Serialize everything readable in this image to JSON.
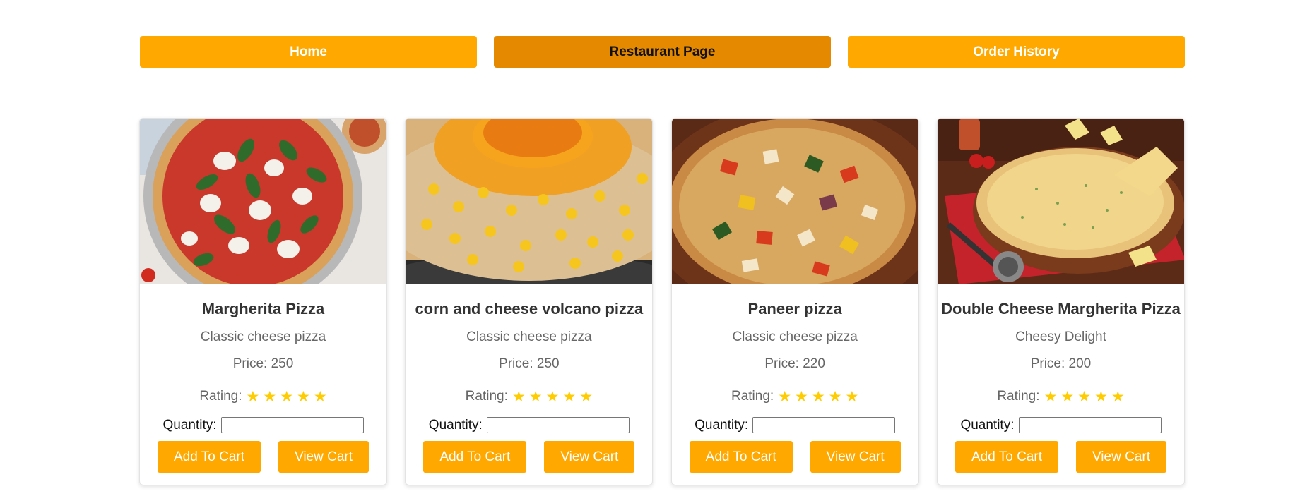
{
  "nav": {
    "home": "Home",
    "restaurant": "Restaurant Page",
    "orders": "Order History"
  },
  "colors": {
    "accent": "#ffa800",
    "accent_active": "#e58a00",
    "star": "#ffcc00"
  },
  "labels": {
    "rating": "Rating:",
    "quantity": "Quantity:",
    "add_to_cart": "Add To Cart",
    "view_cart": "View Cart"
  },
  "products": [
    {
      "name": "Margherita Pizza",
      "description": "Classic cheese pizza",
      "price": "Price: 250",
      "rating": 5,
      "quantity": "",
      "image": "margherita-pizza-image"
    },
    {
      "name": "corn and cheese volcano pizza",
      "description": "Classic cheese pizza",
      "price": "Price: 250",
      "rating": 5,
      "quantity": "",
      "image": "corn-cheese-volcano-pizza-image"
    },
    {
      "name": "Paneer pizza",
      "description": "Classic cheese pizza",
      "price": "Price: 220",
      "rating": 5,
      "quantity": "",
      "image": "paneer-pizza-image"
    },
    {
      "name": "Double Cheese Margherita Pizza",
      "description": "Cheesy Delight",
      "price": "Price: 200",
      "rating": 5,
      "quantity": "",
      "image": "double-cheese-margherita-pizza-image"
    }
  ]
}
